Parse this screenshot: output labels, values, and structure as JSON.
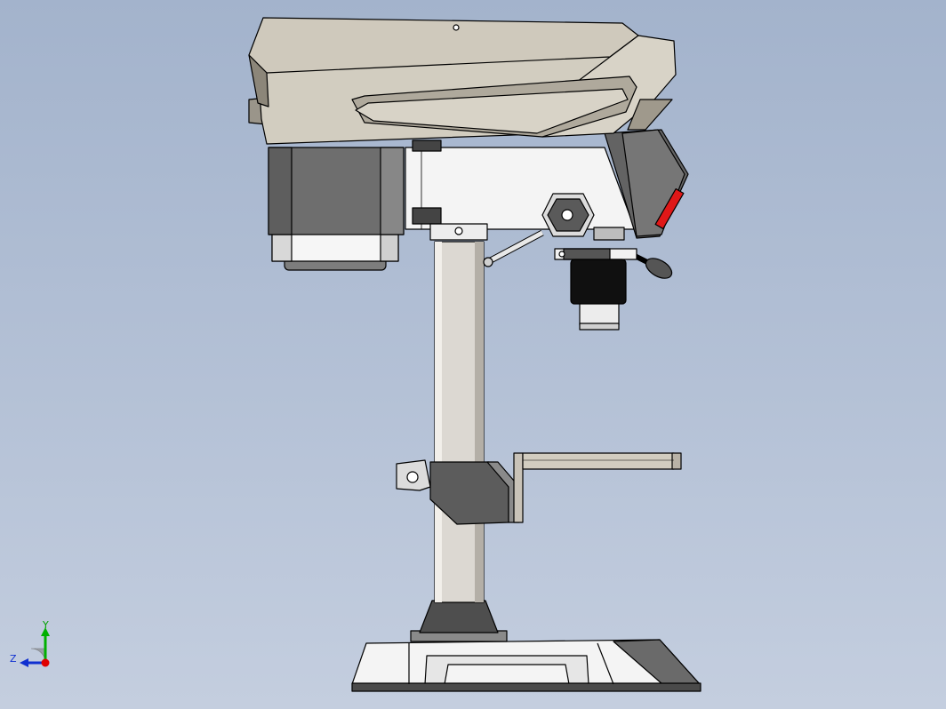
{
  "viewport": {
    "background_top": "#a3b3cc",
    "background_bottom": "#c4cedf",
    "model": "drill-press",
    "view": "side",
    "shading": "shaded-with-edges"
  },
  "triad": {
    "x_axis_color": "#e00000",
    "y_axis_color": "#00b000",
    "z_axis_color": "#1030d0",
    "y_label": "Y",
    "z_label": "Z"
  },
  "colors": {
    "cover": "#d2cdc0",
    "cover_dark": "#8c8679",
    "motor": "#6e6e6e",
    "body": "#f2f2f2",
    "column": "#dcd8d2",
    "iron": "#5a5a5a",
    "accent_red": "#e01818"
  }
}
